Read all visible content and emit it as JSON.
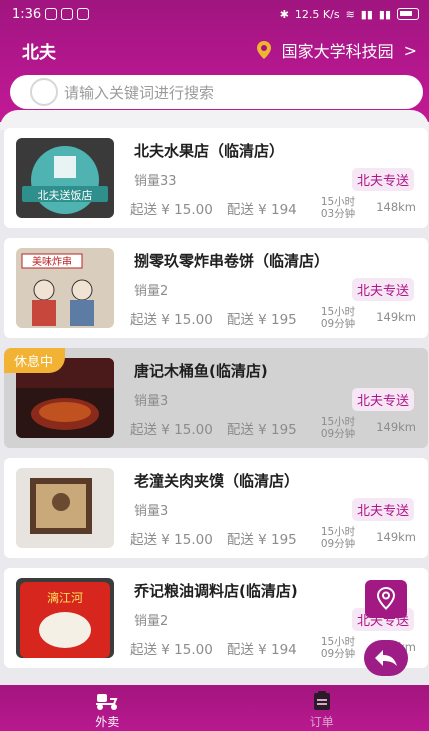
{
  "status_bar": {
    "time": "1:36",
    "net_speed": "12.5 K/s"
  },
  "header": {
    "brand": "北夫",
    "location": "国家大学科技园"
  },
  "search": {
    "placeholder": "请输入关键词进行搜索"
  },
  "stores": [
    {
      "name": "北夫水果店（临清店）",
      "sales": "销量33",
      "tag": "北夫专送",
      "min_order": "起送 ¥ 15.00",
      "delivery_fee": "配送 ¥ 194",
      "time": "15小时03分钟",
      "distance": "148km"
    },
    {
      "name": "捌零玖零炸串卷饼（临清店）",
      "sales": "销量2",
      "tag": "北夫专送",
      "min_order": "起送 ¥ 15.00",
      "delivery_fee": "配送 ¥ 195",
      "time": "15小时09分钟",
      "distance": "149km"
    },
    {
      "name": "唐记木桶鱼(临清店)",
      "sales": "销量3",
      "tag": "北夫专送",
      "min_order": "起送 ¥ 15.00",
      "delivery_fee": "配送 ¥ 195",
      "time": "15小时09分钟",
      "distance": "149km",
      "status": "休息中"
    },
    {
      "name": "老潼关肉夹馍（临清店）",
      "sales": "销量3",
      "tag": "北夫专送",
      "min_order": "起送 ¥ 15.00",
      "delivery_fee": "配送 ¥ 195",
      "time": "15小时09分钟",
      "distance": "149km"
    },
    {
      "name": "乔记粮油调料店(临清店)",
      "sales": "销量2",
      "tag": "北夫专送",
      "min_order": "起送 ¥ 15.00",
      "delivery_fee": "配送 ¥ 194",
      "time": "15小时09分钟",
      "distance": "148km"
    }
  ],
  "thumb_texts": {
    "store1": "北夫送饭店",
    "store2": "美味炸串",
    "store5": "漓江河"
  },
  "tabbar": {
    "tab1": "外卖",
    "tab2": "订单"
  },
  "colors": {
    "brand": "#b0138a",
    "tag_bg": "#f6e7f4",
    "rest_badge": "#f2b233"
  }
}
